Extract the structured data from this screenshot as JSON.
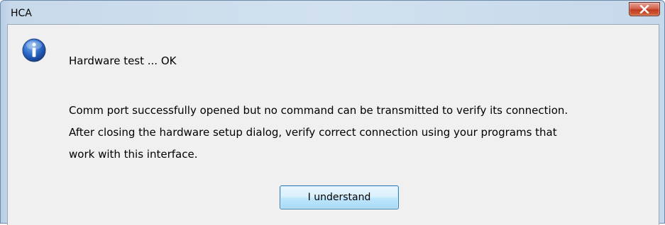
{
  "window": {
    "title": "HCA"
  },
  "dialog": {
    "icon": "info-icon",
    "headline": "Hardware test ... OK",
    "body_lines": [
      "Comm port successfully opened but no command can be transmitted to verify its connection.",
      "After closing the hardware setup dialog, verify correct connection using your programs that",
      "work with this interface."
    ],
    "button_label": "I understand"
  },
  "controls": {
    "close_icon": "close-icon"
  },
  "colors": {
    "client_background": "#f0f0f0",
    "frame": "#c8d9ea",
    "close_button": "#c1391f",
    "button_border": "#3c7fb1"
  }
}
